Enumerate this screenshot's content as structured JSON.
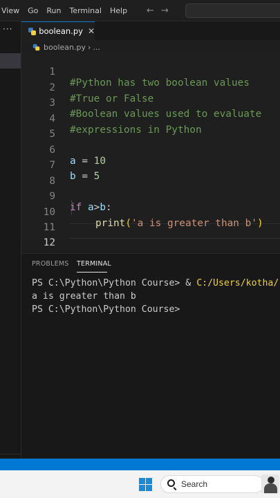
{
  "menu": {
    "items": [
      "View",
      "Go",
      "Run",
      "Terminal",
      "Help"
    ],
    "back_icon": "arrow-left-icon",
    "forward_icon": "arrow-right-icon"
  },
  "sidebar": {
    "more_label": "···"
  },
  "editor": {
    "tab_label": "boolean.py",
    "tab_close": "✕",
    "breadcrumb": {
      "file": "boolean.py",
      "separator": "›",
      "more": "..."
    },
    "line_numbers": [
      "1",
      "2",
      "3",
      "4",
      "5",
      "6",
      "7",
      "8",
      "9",
      "10",
      "11",
      "12"
    ],
    "active_line": "12",
    "lines": {
      "l1": "#Python has two boolean values",
      "l2": "#True or False",
      "l3": "#Boolean values used to evaluate",
      "l4": "#expressions in Python",
      "l6_var": "a",
      "l6_op": " = ",
      "l6_num": "10",
      "l7_var": "b",
      "l7_op": " = ",
      "l7_num": "5",
      "l9_kw": "if",
      "l9_a": "a",
      "l9_op": ">",
      "l9_b": "b",
      "l9_colon": ":",
      "l10_fn": "print",
      "l10_open": "(",
      "l10_str": "'a is greater than b'",
      "l10_close": ")"
    }
  },
  "panel": {
    "tabs": {
      "problems": "PROBLEMS",
      "terminal": "TERMINAL"
    },
    "terminal": {
      "line1_prompt": "PS C:\\Python\\Python Course> & ",
      "line1_path": "C:/Users/kotha/",
      "line2": "a is greater than b",
      "line3": "PS C:\\Python\\Python Course>"
    }
  },
  "taskbar": {
    "search_label": "Search"
  },
  "colors": {
    "accent": "#0078d4",
    "comment": "#6a9955",
    "variable": "#9cdcfe",
    "number": "#b5cea8",
    "keyword": "#c586c0",
    "function": "#dcdcaa",
    "string": "#ce9178"
  }
}
